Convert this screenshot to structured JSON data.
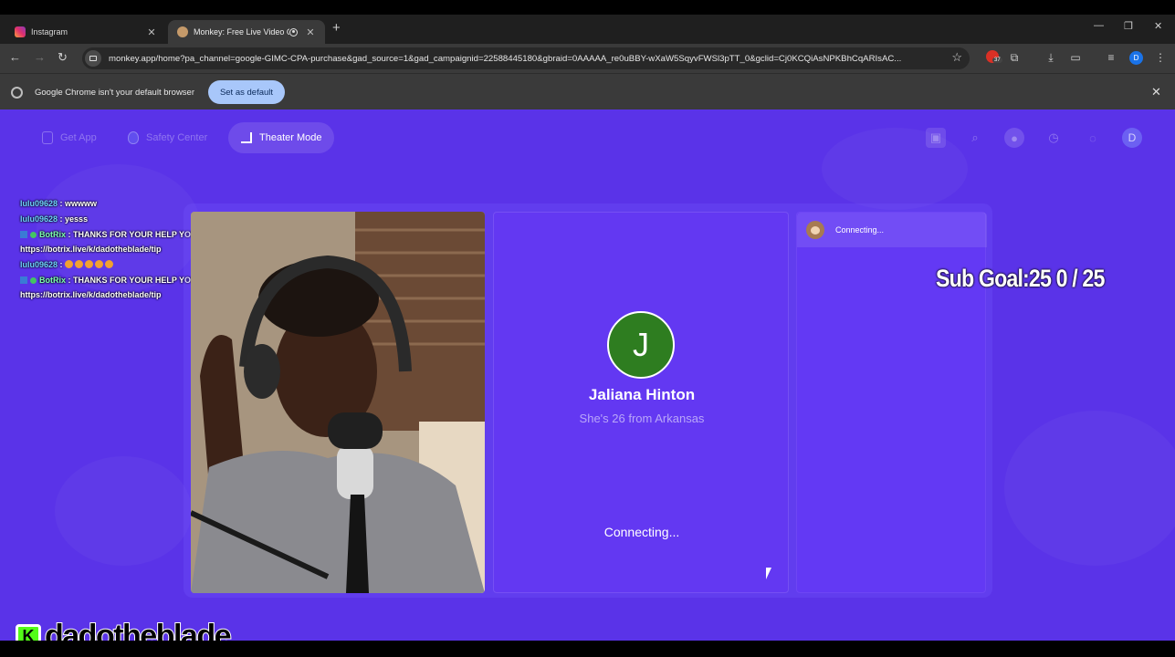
{
  "browser": {
    "tabs": [
      {
        "title": "Instagram",
        "active": false
      },
      {
        "title": "Monkey: Free Live Video Ch",
        "active": true
      }
    ],
    "url": "monkey.app/home?pa_channel=google-GIMC-CPA-purchase&gad_source=1&gad_campaignid=22588445180&gbraid=0AAAAA_re0uBBY-wXaW5SqyvFWSl3pTT_0&gclid=Cj0KCQiAsNPKBhCqARIsAC...",
    "extension_badge": "37",
    "profile_initial": "D"
  },
  "infobar": {
    "message": "Google Chrome isn't your default browser",
    "button": "Set as default"
  },
  "nav": {
    "get_app": "Get App",
    "safety_center": "Safety Center",
    "theater_mode": "Theater Mode",
    "avatar_initial": "D"
  },
  "chat": [
    {
      "user": "lulu09628",
      "message": ": wwwww"
    },
    {
      "user": "lulu09628",
      "message": ": yesss"
    },
    {
      "user": "BotRix",
      "message": ": THANKS FOR YOUR HELP YOU CAN DONATE HERE",
      "cont": "https://botrix.live/k/dadotheblade/tip"
    },
    {
      "user": "lulu09628",
      "message": ":"
    },
    {
      "user": "BotRix",
      "message": ": THANKS FOR YOUR HELP YOU CAN DONATE HERE",
      "cont": "https://botrix.live/k/dadotheblade/tip"
    }
  ],
  "match": {
    "initial": "J",
    "name": "Jaliana Hinton",
    "info": "She's 26 from Arkansas",
    "status": "Connecting..."
  },
  "side": {
    "status": "Connecting..."
  },
  "overlay": {
    "sub_goal": "Sub Goal:25  0 / 25",
    "streamer": "dadotheblade"
  },
  "colors": {
    "page_bg": "#5a33e8",
    "avatar_bg": "#2e7d20",
    "kick_green": "#53fc18"
  }
}
